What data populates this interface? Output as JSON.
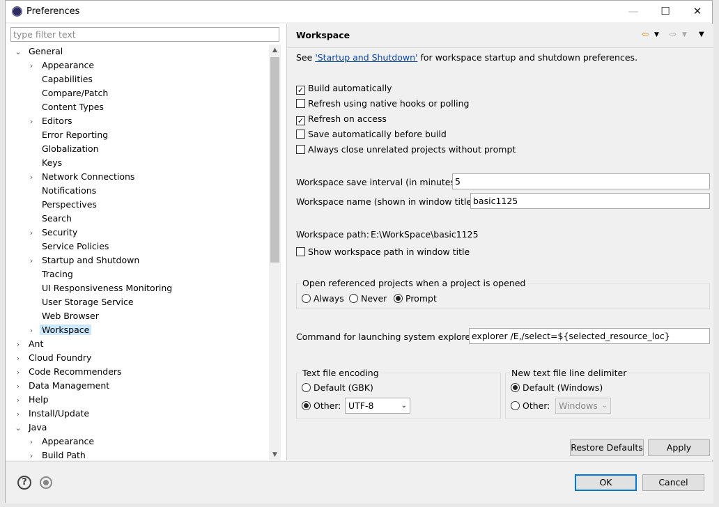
{
  "window": {
    "title": "Preferences"
  },
  "filter": {
    "placeholder": "type filter text"
  },
  "tree": [
    {
      "label": "General",
      "indent": 0,
      "tw": "expanded"
    },
    {
      "label": "Appearance",
      "indent": 1,
      "tw": "collapsed"
    },
    {
      "label": "Capabilities",
      "indent": 1,
      "tw": "none"
    },
    {
      "label": "Compare/Patch",
      "indent": 1,
      "tw": "none"
    },
    {
      "label": "Content Types",
      "indent": 1,
      "tw": "none"
    },
    {
      "label": "Editors",
      "indent": 1,
      "tw": "collapsed"
    },
    {
      "label": "Error Reporting",
      "indent": 1,
      "tw": "none"
    },
    {
      "label": "Globalization",
      "indent": 1,
      "tw": "none"
    },
    {
      "label": "Keys",
      "indent": 1,
      "tw": "none"
    },
    {
      "label": "Network Connections",
      "indent": 1,
      "tw": "collapsed"
    },
    {
      "label": "Notifications",
      "indent": 1,
      "tw": "none"
    },
    {
      "label": "Perspectives",
      "indent": 1,
      "tw": "none"
    },
    {
      "label": "Search",
      "indent": 1,
      "tw": "none"
    },
    {
      "label": "Security",
      "indent": 1,
      "tw": "collapsed"
    },
    {
      "label": "Service Policies",
      "indent": 1,
      "tw": "none"
    },
    {
      "label": "Startup and Shutdown",
      "indent": 1,
      "tw": "collapsed"
    },
    {
      "label": "Tracing",
      "indent": 1,
      "tw": "none"
    },
    {
      "label": "UI Responsiveness Monitoring",
      "indent": 1,
      "tw": "none"
    },
    {
      "label": "User Storage Service",
      "indent": 1,
      "tw": "none"
    },
    {
      "label": "Web Browser",
      "indent": 1,
      "tw": "none"
    },
    {
      "label": "Workspace",
      "indent": 1,
      "tw": "collapsed",
      "selected": true
    },
    {
      "label": "Ant",
      "indent": 0,
      "tw": "collapsed"
    },
    {
      "label": "Cloud Foundry",
      "indent": 0,
      "tw": "collapsed"
    },
    {
      "label": "Code Recommenders",
      "indent": 0,
      "tw": "collapsed"
    },
    {
      "label": "Data Management",
      "indent": 0,
      "tw": "collapsed"
    },
    {
      "label": "Help",
      "indent": 0,
      "tw": "collapsed"
    },
    {
      "label": "Install/Update",
      "indent": 0,
      "tw": "collapsed"
    },
    {
      "label": "Java",
      "indent": 0,
      "tw": "expanded"
    },
    {
      "label": "Appearance",
      "indent": 1,
      "tw": "collapsed"
    },
    {
      "label": "Build Path",
      "indent": 1,
      "tw": "collapsed"
    }
  ],
  "page": {
    "title": "Workspace",
    "see_prefix": "See",
    "see_link": "'Startup and Shutdown'",
    "see_suffix": "for workspace startup and shutdown preferences.",
    "checkboxes": [
      {
        "label": "Build automatically",
        "checked": true
      },
      {
        "label": "Refresh using native hooks or polling",
        "checked": false
      },
      {
        "label": "Refresh on access",
        "checked": true
      },
      {
        "label": "Save automatically before build",
        "checked": false
      },
      {
        "label": "Always close unrelated projects without prompt",
        "checked": false
      }
    ],
    "save_interval_label": "Workspace save interval (in minutes):",
    "save_interval_value": "5",
    "name_label": "Workspace name (shown in window title):",
    "name_value": "basic1125",
    "path_label": "Workspace path:",
    "path_value": "E:\\WorkSpace\\basic1125",
    "show_path_label": "Show workspace path in window title",
    "open_ref_group": "Open referenced projects when a project is opened",
    "open_ref_options": [
      {
        "label": "Always",
        "selected": false
      },
      {
        "label": "Never",
        "selected": false
      },
      {
        "label": "Prompt",
        "selected": true
      }
    ],
    "explorer_label": "Command for launching system explorer:",
    "explorer_value": "explorer /E,/select=${selected_resource_loc}",
    "encoding_group": "Text file encoding",
    "encoding_default": "Default (GBK)",
    "encoding_other": "Other:",
    "encoding_value": "UTF-8",
    "delimiter_group": "New text file line delimiter",
    "delimiter_default": "Default (Windows)",
    "delimiter_other": "Other:",
    "delimiter_value": "Windows",
    "restore_defaults": "Restore Defaults",
    "apply": "Apply"
  },
  "footer": {
    "ok": "OK",
    "cancel": "Cancel"
  }
}
